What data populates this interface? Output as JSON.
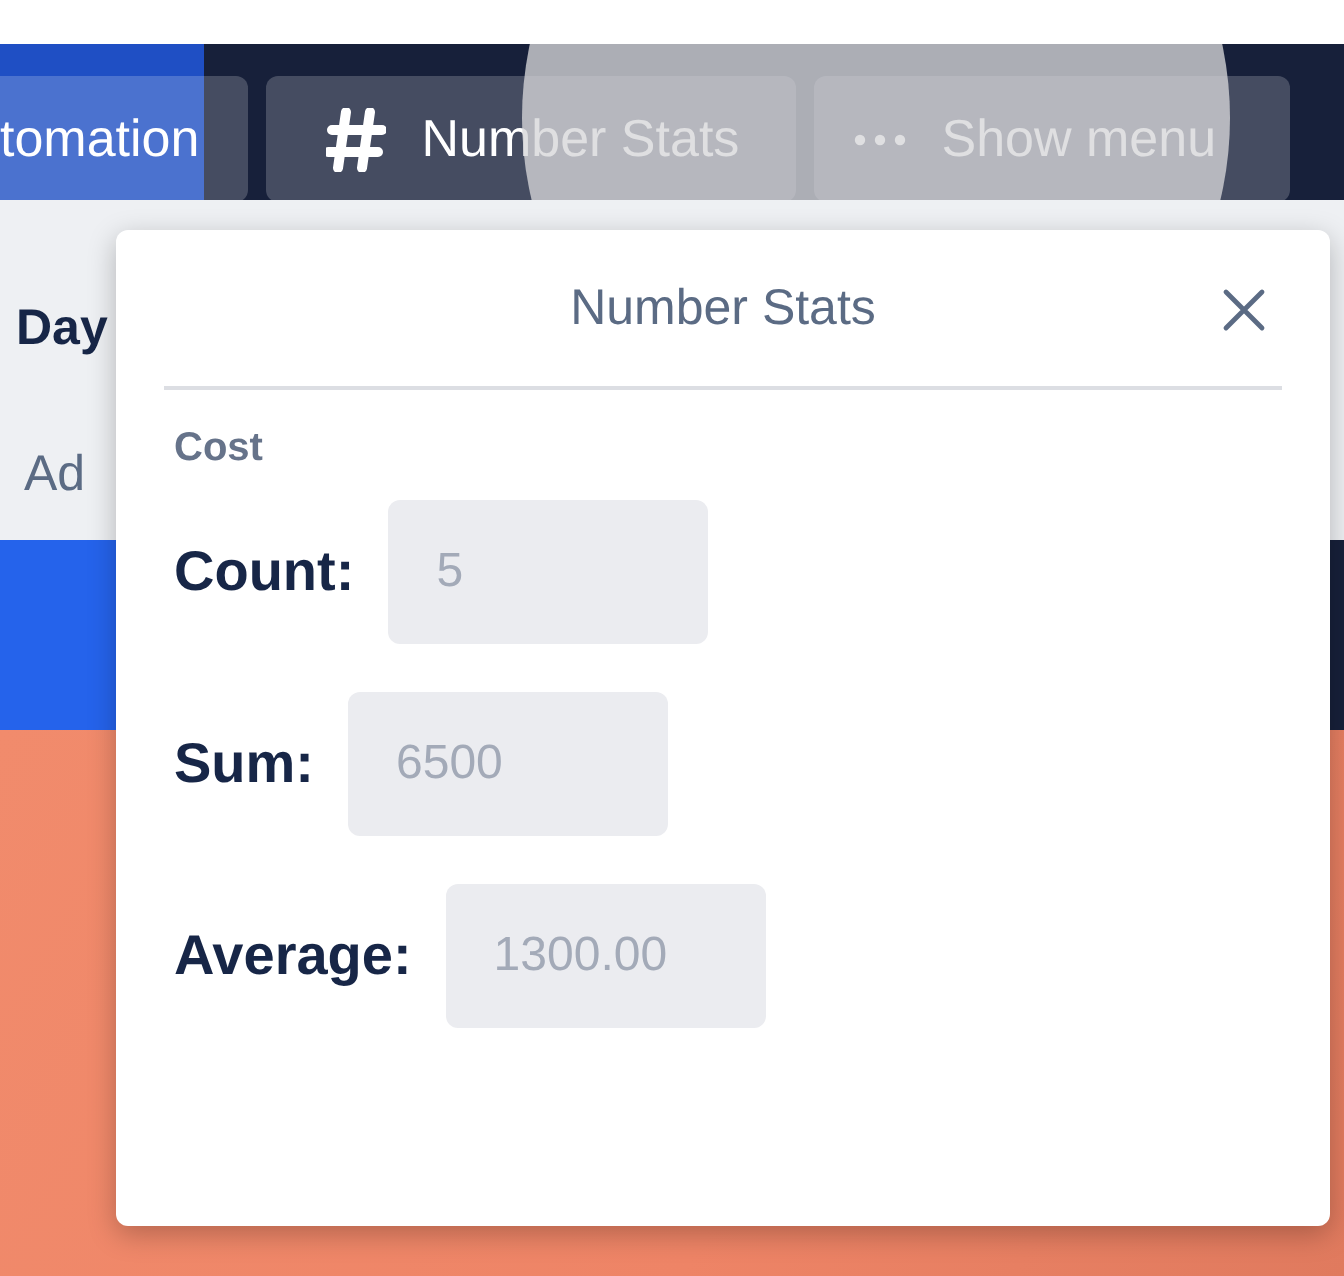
{
  "header": {
    "buttons": [
      {
        "label": "tomation",
        "kind": "plain"
      },
      {
        "label": "Number Stats",
        "kind": "hash"
      },
      {
        "label": "Show menu",
        "kind": "more"
      }
    ]
  },
  "background_panel": {
    "heading": "Day",
    "link": "Ad"
  },
  "modal": {
    "title": "Number Stats",
    "section": "Cost",
    "stats": [
      {
        "label": "Count:",
        "value": "5",
        "disabled": true
      },
      {
        "label": "Sum:",
        "value": "6500",
        "disabled": true
      },
      {
        "label": "Average:",
        "value": "1300.00",
        "disabled": true
      }
    ]
  }
}
